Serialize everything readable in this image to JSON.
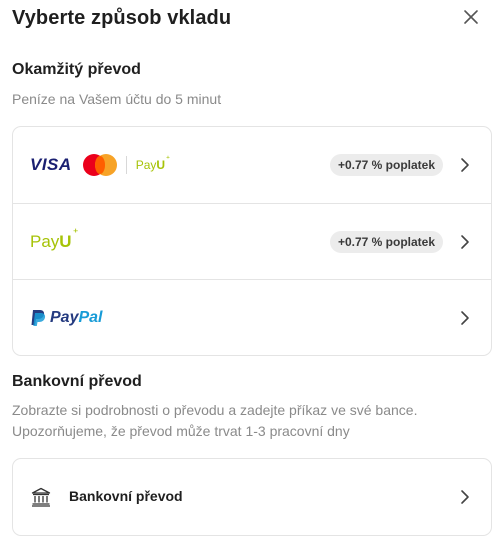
{
  "dialog": {
    "title": "Vyberte způsob vkladu",
    "close_icon": "close-icon"
  },
  "instant": {
    "title": "Okamžitý převod",
    "description": "Peníze na Vašem účtu do 5 minut",
    "options": [
      {
        "logos": [
          "VISA",
          "Mastercard",
          "PayU"
        ],
        "fee": "+0.77 % poplatek"
      },
      {
        "logos": [
          "PayU"
        ],
        "fee": "+0.77 % poplatek"
      },
      {
        "logos": [
          "PayPal"
        ],
        "fee": ""
      }
    ]
  },
  "brands": {
    "visa": "VISA",
    "payu_pay": "Pay",
    "payu_u": "U",
    "paypal_pay": "Pay",
    "paypal_pal": "Pal"
  },
  "bank": {
    "title": "Bankovní převod",
    "description_line1": "Zobrazte si podrobnosti o převodu a zadejte příkaz ve své bance.",
    "description_line2": "Upozorňujeme, že převod může trvat 1-3 pracovní dny",
    "option_label": "Bankovní převod",
    "icon": "bank-icon"
  },
  "colors": {
    "visa": "#1a1f71",
    "payu": "#a6c307",
    "paypal_dark": "#253b80",
    "paypal_light": "#179bd7",
    "fee_badge_bg": "#ececec"
  }
}
